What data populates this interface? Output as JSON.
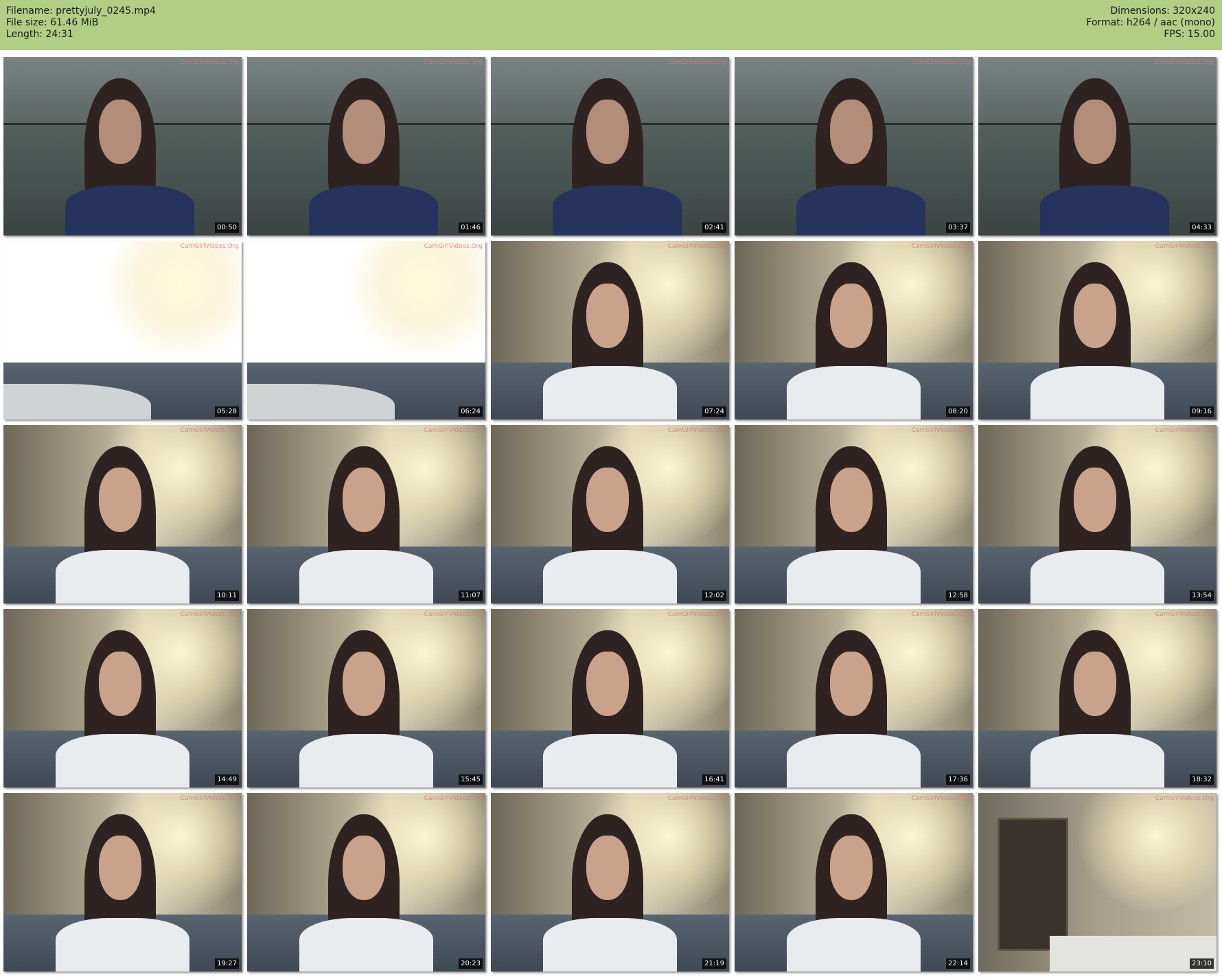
{
  "header": {
    "filename": "Filename: prettyjuly_0245.mp4",
    "filesize": "File size: 61.46 MiB",
    "length": "Length: 24:31",
    "dimensions": "Dimensions: 320x240",
    "format": "Format: h264 / aac (mono)",
    "fps": "FPS: 15.00"
  },
  "watermark": "CamGirlVideos.Org",
  "thumbnails": [
    {
      "ts": "00:50",
      "scene": "dark"
    },
    {
      "ts": "01:46",
      "scene": "dark"
    },
    {
      "ts": "02:41",
      "scene": "dark"
    },
    {
      "ts": "03:37",
      "scene": "dark"
    },
    {
      "ts": "04:33",
      "scene": "dark"
    },
    {
      "ts": "05:28",
      "scene": "empty"
    },
    {
      "ts": "06:24",
      "scene": "empty"
    },
    {
      "ts": "07:24",
      "scene": "lit"
    },
    {
      "ts": "08:20",
      "scene": "lit"
    },
    {
      "ts": "09:16",
      "scene": "lit"
    },
    {
      "ts": "10:11",
      "scene": "lit"
    },
    {
      "ts": "11:07",
      "scene": "lit"
    },
    {
      "ts": "12:02",
      "scene": "lit"
    },
    {
      "ts": "12:58",
      "scene": "lit"
    },
    {
      "ts": "13:54",
      "scene": "lit"
    },
    {
      "ts": "14:49",
      "scene": "lit"
    },
    {
      "ts": "15:45",
      "scene": "lit"
    },
    {
      "ts": "16:41",
      "scene": "lit"
    },
    {
      "ts": "17:36",
      "scene": "lit"
    },
    {
      "ts": "18:32",
      "scene": "lit"
    },
    {
      "ts": "19:27",
      "scene": "lit"
    },
    {
      "ts": "20:23",
      "scene": "lit"
    },
    {
      "ts": "21:19",
      "scene": "lit"
    },
    {
      "ts": "22:14",
      "scene": "lit"
    },
    {
      "ts": "23:10",
      "scene": "room"
    }
  ]
}
